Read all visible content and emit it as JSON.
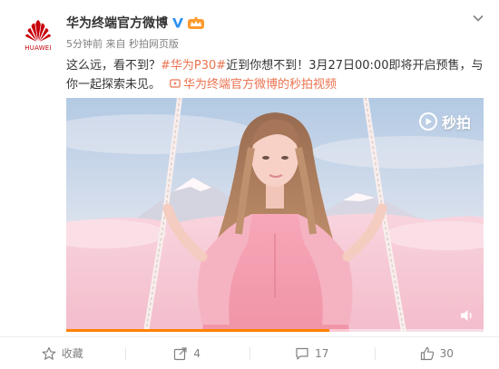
{
  "account": {
    "name": "华为终端官方微博",
    "avatar_text": "HUAWEI",
    "brand_color": "#c7000b",
    "verified_icon": "verified-v-icon",
    "member_icon": "member-crown-icon"
  },
  "meta": "5分钟前 来自 秒拍网页版",
  "post": {
    "text_before": "这么远，看不到？",
    "hashtag": "#华为P30#",
    "text_after": "近到你想不到！3月27日00:00即将开启预售，与你一起探索未见。",
    "video_link": "华为终端官方微博的秒拍视频",
    "link_color": "#eb7350"
  },
  "video": {
    "logo_text": "秒拍",
    "progress": 0.63,
    "progress_color": "#ff8200"
  },
  "actions": {
    "favorite_label": "收藏",
    "forward_count": "4",
    "comment_count": "17",
    "like_count": "30"
  }
}
